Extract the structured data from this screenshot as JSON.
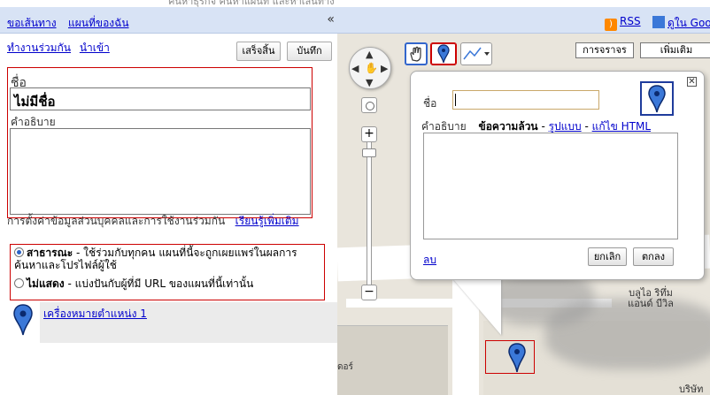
{
  "top_strip": {
    "text": "ค้นหาธุรกิจ ค้นหาแผนที่ และหาเส้นทาง"
  },
  "left_panel": {
    "tabs": [
      {
        "label": "ขอเส้นทาง"
      },
      {
        "label": "แผนที่ของฉัน"
      }
    ],
    "collapse_label": "«",
    "actions": [
      {
        "label": "ทำงานร่วมกัน"
      },
      {
        "label": "นำเข้า"
      }
    ],
    "done_button": "เสร็จสิ้น",
    "save_button": "บันทึก",
    "name_label": "ชื่อ",
    "name_value": "ไม่มีชื่อ",
    "description_label": "คำอธิบาย",
    "privacy_title": "การตั้งค่าข้อมูลส่วนบุคคลและการใช้งานร่วมกัน",
    "learn_more": "เรียนรู้เพิ่มเติม",
    "public_option_bold": "สาธารณะ",
    "public_option_text": " - ใช้ร่วมกับทุกคน แผนที่นี้จะถูกเผยแพร่ในผลการค้นหาและโปรไฟล์ผู้ใช้",
    "unlisted_option_bold": "ไม่แสดง",
    "unlisted_option_text": " - แบ่งปันกับผู้ที่มี URL ของแผนที่นี้เท่านั้น",
    "selected_privacy": "public",
    "placemark_link": "เครื่องหมายตำแหน่ง 1"
  },
  "map": {
    "rss_label": "RSS",
    "earth_label": "ดูใน Google Earth",
    "traffic_button": "การจราจร",
    "more_button": "เพิ่มเติม",
    "zoom_in": "+",
    "zoom_out": "−",
    "infowindow": {
      "close": "✕",
      "name_label": "ชื่อ",
      "description_label": "คำอธิบาย",
      "plain_text": "ข้อความล้วน",
      "rich_text": "รูปแบบ",
      "edit_html": "แก้ไข HTML",
      "separator": " - ",
      "delete_link": "ลบ",
      "cancel_button": "ยกเลิก",
      "ok_button": "ตกลง"
    },
    "labels": {
      "poi_1": "บลูไอ ริทึ่ม แอนด์ บีวิล",
      "poi_2": "บริษัท ดา",
      "poi_3": "ดอร์"
    }
  },
  "colors": {
    "tab_bar": "#d8e3f5",
    "marker": "#3b78d8",
    "highlight": "#cc0000",
    "link": "#0000cc"
  }
}
